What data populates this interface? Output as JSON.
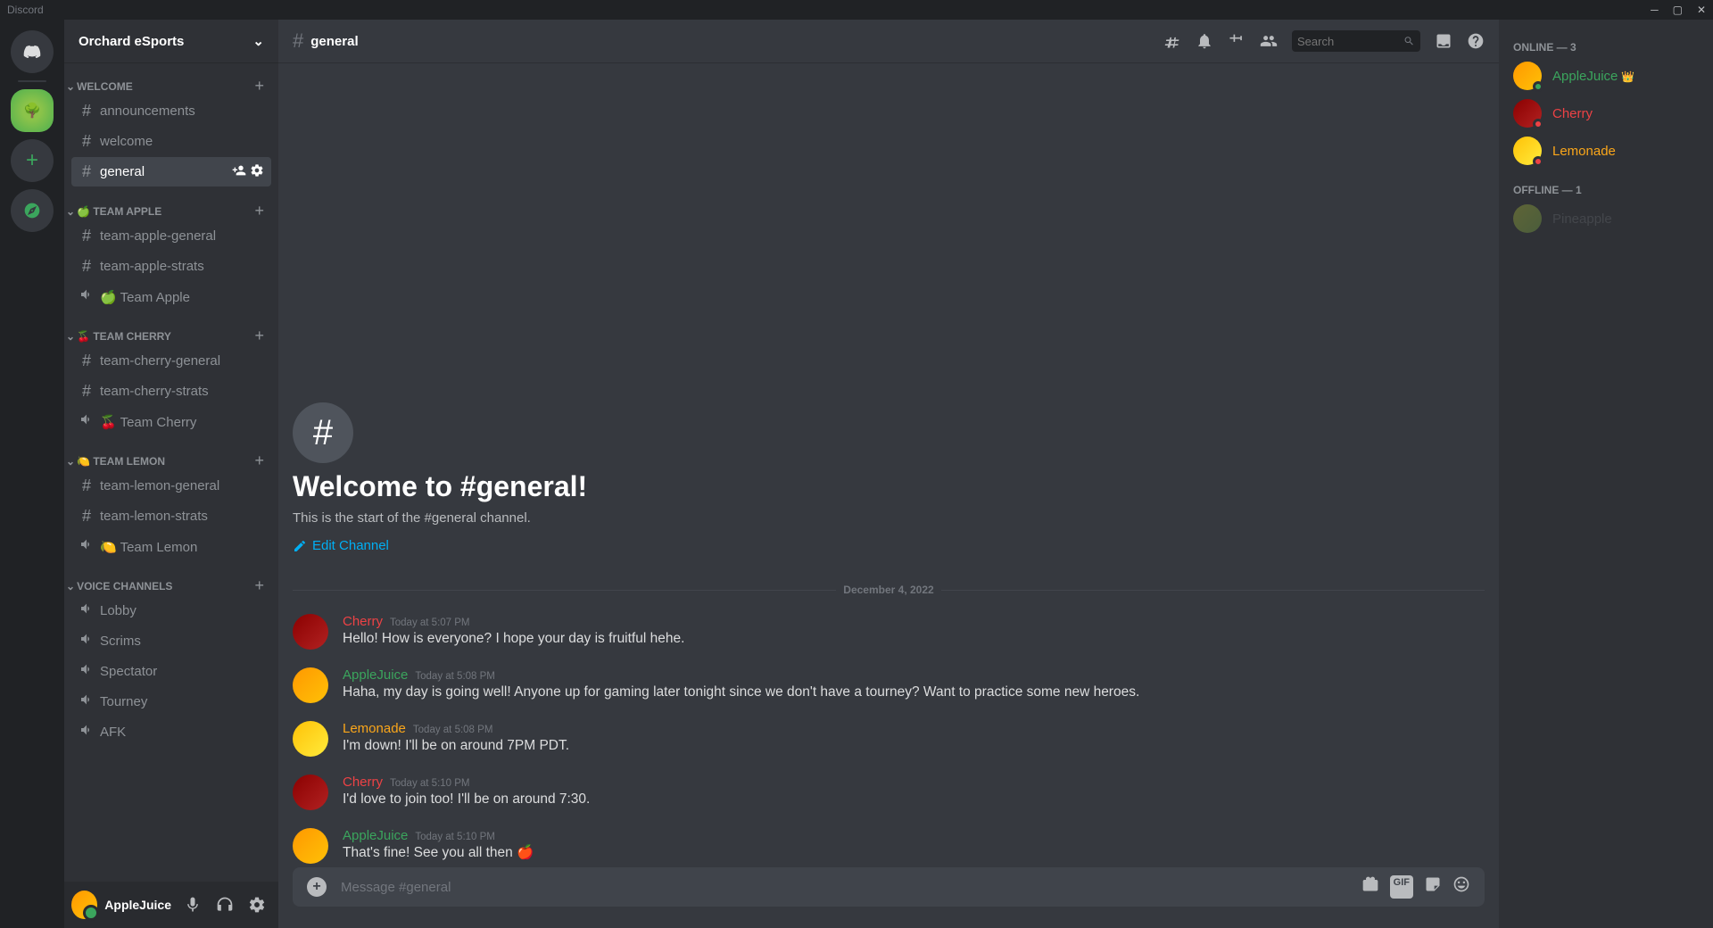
{
  "app_name": "Discord",
  "server_name": "Orchard eSports",
  "active_channel": "general",
  "channel_header_title": "general",
  "search_placeholder": "Search",
  "categories": [
    {
      "name": "Welcome",
      "emoji": "",
      "channels": [
        {
          "type": "text",
          "name": "announcements"
        },
        {
          "type": "text",
          "name": "welcome"
        },
        {
          "type": "text",
          "name": "general",
          "active": true
        }
      ]
    },
    {
      "name": "Team Apple",
      "emoji": "🍏",
      "channels": [
        {
          "type": "text",
          "name": "team-apple-general"
        },
        {
          "type": "text",
          "name": "team-apple-strats"
        },
        {
          "type": "voice",
          "name": "Team Apple",
          "emoji": "🍏"
        }
      ]
    },
    {
      "name": "Team Cherry",
      "emoji": "🍒",
      "channels": [
        {
          "type": "text",
          "name": "team-cherry-general"
        },
        {
          "type": "text",
          "name": "team-cherry-strats"
        },
        {
          "type": "voice",
          "name": "Team Cherry",
          "emoji": "🍒"
        }
      ]
    },
    {
      "name": "Team Lemon",
      "emoji": "🍋",
      "channels": [
        {
          "type": "text",
          "name": "team-lemon-general"
        },
        {
          "type": "text",
          "name": "team-lemon-strats"
        },
        {
          "type": "voice",
          "name": "Team Lemon",
          "emoji": "🍋"
        }
      ]
    },
    {
      "name": "Voice Channels",
      "emoji": "",
      "channels": [
        {
          "type": "voice",
          "name": "Lobby"
        },
        {
          "type": "voice",
          "name": "Scrims"
        },
        {
          "type": "voice",
          "name": "Spectator"
        },
        {
          "type": "voice",
          "name": "Tourney"
        },
        {
          "type": "voice",
          "name": "AFK"
        }
      ]
    }
  ],
  "current_user": {
    "name": "AppleJuice"
  },
  "welcome": {
    "title": "Welcome to #general!",
    "subtitle": "This is the start of the #general channel.",
    "edit_label": "Edit Channel"
  },
  "date_divider": "December 4, 2022",
  "messages": [
    {
      "author": "Cherry",
      "color": "#ed4245",
      "avatar_bg": "linear-gradient(135deg,#8b0000,#b22222)",
      "time": "Today at 5:07 PM",
      "text": "Hello! How is everyone? I hope your day is fruitful hehe."
    },
    {
      "author": "AppleJuice",
      "color": "#3ba55d",
      "avatar_bg": "linear-gradient(135deg,#ff9800,#ffc107)",
      "time": "Today at 5:08 PM",
      "text": "Haha, my day is going well! Anyone up for gaming later tonight since we don't have a tourney? Want to practice some new heroes."
    },
    {
      "author": "Lemonade",
      "color": "#faa61a",
      "avatar_bg": "linear-gradient(135deg,#ffc107,#ffeb3b)",
      "time": "Today at 5:08 PM",
      "text": "I'm down! I'll be on around 7PM PDT."
    },
    {
      "author": "Cherry",
      "color": "#ed4245",
      "avatar_bg": "linear-gradient(135deg,#8b0000,#b22222)",
      "time": "Today at 5:10 PM",
      "text": "I'd love to join too! I'll be on around 7:30."
    },
    {
      "author": "AppleJuice",
      "color": "#3ba55d",
      "avatar_bg": "linear-gradient(135deg,#ff9800,#ffc107)",
      "time": "Today at 5:10 PM",
      "text": "That's fine! See you all then 🍎"
    }
  ],
  "message_placeholder": "Message #general",
  "members": {
    "online_label": "Online — 3",
    "offline_label": "Offline — 1",
    "online": [
      {
        "name": "AppleJuice",
        "color": "#3ba55d",
        "status": "online",
        "owner": true,
        "avatar_bg": "linear-gradient(135deg,#ff9800,#ffc107)"
      },
      {
        "name": "Cherry",
        "color": "#ed4245",
        "status": "dnd",
        "avatar_bg": "linear-gradient(135deg,#8b0000,#b22222)"
      },
      {
        "name": "Lemonade",
        "color": "#faa61a",
        "status": "dnd",
        "avatar_bg": "linear-gradient(135deg,#ffc107,#ffeb3b)"
      }
    ],
    "offline": [
      {
        "name": "Pineapple",
        "color": "#72767d",
        "avatar_bg": "linear-gradient(135deg,#cddc39,#8bc34a)"
      }
    ]
  }
}
